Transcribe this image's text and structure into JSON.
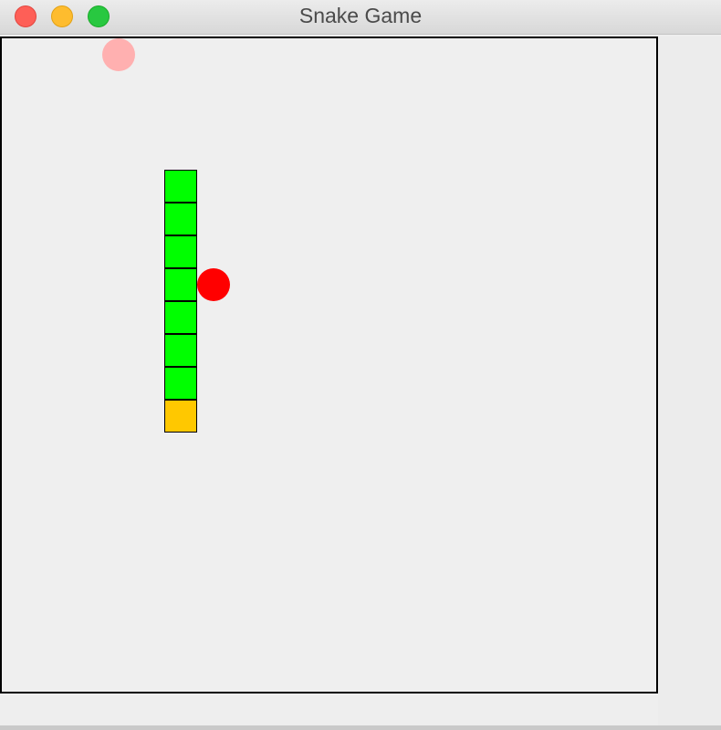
{
  "window": {
    "title": "Snake Game"
  },
  "colors": {
    "snake_body": "#00ff00",
    "snake_tail": "#ffc800",
    "food": "#ff0000",
    "ghost_food": "#ffb0b0",
    "board_border": "#000000"
  },
  "game": {
    "grid_cols": 20,
    "grid_rows": 20,
    "snake": [
      {
        "col": 5,
        "row": 4,
        "part": "body"
      },
      {
        "col": 5,
        "row": 5,
        "part": "body"
      },
      {
        "col": 5,
        "row": 6,
        "part": "body"
      },
      {
        "col": 5,
        "row": 7,
        "part": "body"
      },
      {
        "col": 5,
        "row": 8,
        "part": "body"
      },
      {
        "col": 5,
        "row": 9,
        "part": "body"
      },
      {
        "col": 5,
        "row": 10,
        "part": "body"
      },
      {
        "col": 5,
        "row": 11,
        "part": "tail"
      }
    ],
    "food": {
      "col": 6,
      "row": 7
    },
    "ghost_food": {
      "col": 3,
      "row": 0
    }
  }
}
